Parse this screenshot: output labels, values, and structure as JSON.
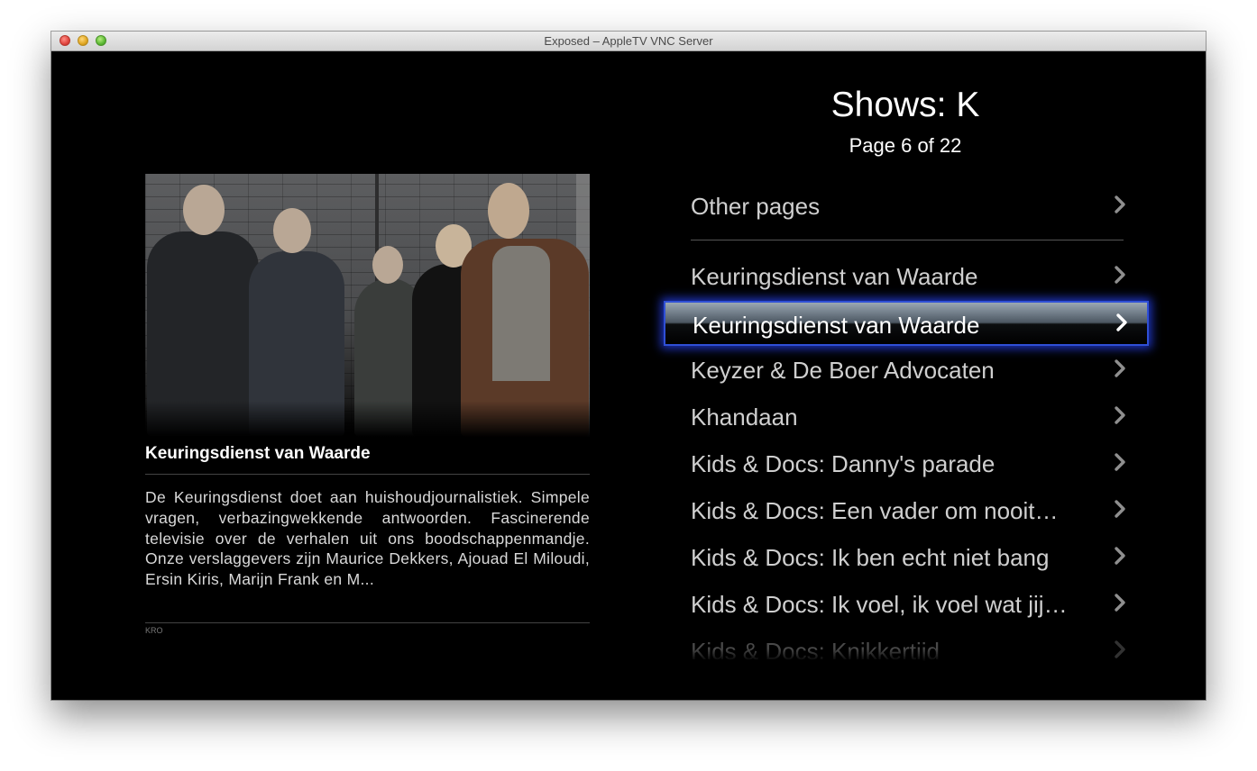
{
  "window": {
    "title": "Exposed – AppleTV VNC Server"
  },
  "header": {
    "title": "Shows: K",
    "subtitle": "Page 6 of 22"
  },
  "detail": {
    "title": "Keuringsdienst van Waarde",
    "description": "De Keuringsdienst doet aan huishoudjournalistiek. Simpele vragen, verbazingwekkende antwoorden. Fascinerende televisie over de verhalen uit ons boodschappenmandje. Onze verslaggevers zijn Maurice Dekkers, Ajouad El Miloudi, Ersin Kiris, Marijn Frank en M...",
    "network": "KRO",
    "image_icon": "group-photo"
  },
  "menu": {
    "other_pages": "Other pages",
    "items": [
      {
        "label": "Keuringsdienst van Waarde"
      },
      {
        "label": "Keuringsdienst van Waarde",
        "selected": true
      },
      {
        "label": "Keyzer & De Boer Advocaten"
      },
      {
        "label": "Khandaan"
      },
      {
        "label": "Kids & Docs: Danny's parade"
      },
      {
        "label": "Kids & Docs: Een vader om nooit…"
      },
      {
        "label": "Kids & Docs: Ik ben echt niet bang"
      },
      {
        "label": "Kids & Docs: Ik voel, ik voel wat jij…"
      },
      {
        "label": "Kids & Docs: Knikkertijd"
      }
    ],
    "chevron_icon": "chevron-right-icon",
    "selection_color": "#2f4fd6"
  }
}
